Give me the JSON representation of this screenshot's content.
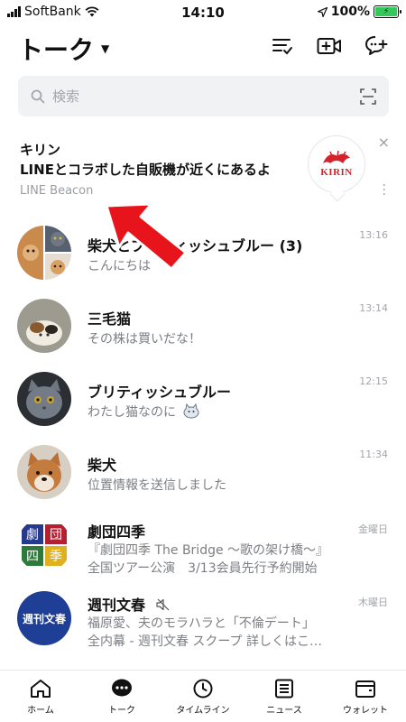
{
  "status_bar": {
    "carrier": "SoftBank",
    "time": "14:10",
    "battery": "100%"
  },
  "header": {
    "title": "トーク",
    "icons": [
      "sort-list-icon",
      "video-call-add-icon",
      "chat-add-icon"
    ]
  },
  "search": {
    "placeholder": "検索"
  },
  "beacon": {
    "title": "キリン",
    "message": "LINEとコラボした自販機が近くにあるよ",
    "source": "LINE Beacon",
    "logo_text": "KIRIN",
    "close": "×"
  },
  "chats": [
    {
      "name": "柴犬とブリティッシュブルー (3)",
      "preview": "こんにちは",
      "time": "13:16"
    },
    {
      "name": "三毛猫",
      "preview": "その株は買いだな！",
      "time": "13:14"
    },
    {
      "name": "ブリティッシュブルー",
      "preview": "わたし猫なのに",
      "time": "12:15"
    },
    {
      "name": "柴犬",
      "preview": "位置情報を送信しました",
      "time": "11:34"
    },
    {
      "name": "劇団四季",
      "preview": "『劇団四季 The Bridge 〜歌の架け橋〜』",
      "preview2": "全国ツアー公演　3/13会員先行予約開始",
      "time": "金曜日",
      "logo_chars": [
        "劇",
        "団",
        "四",
        "季"
      ]
    },
    {
      "name": "週刊文春",
      "preview": "福原愛、夫のモラハラと「不倫デート」",
      "preview2": "全内幕 - 週刊文春 スクープ 詳しくはこ…",
      "time": "木曜日",
      "logo_text": "週刊文春"
    }
  ],
  "tabs": [
    {
      "label": "ホーム",
      "icon": "home-icon"
    },
    {
      "label": "トーク",
      "icon": "talk-icon"
    },
    {
      "label": "タイムライン",
      "icon": "timeline-clock-icon"
    },
    {
      "label": "ニュース",
      "icon": "news-icon"
    },
    {
      "label": "ウォレット",
      "icon": "wallet-icon"
    }
  ],
  "colors": {
    "battery": "#34c759",
    "arrow": "#e8141c",
    "kirin_red": "#d6232b",
    "bunshun_blue": "#1f3f96"
  }
}
